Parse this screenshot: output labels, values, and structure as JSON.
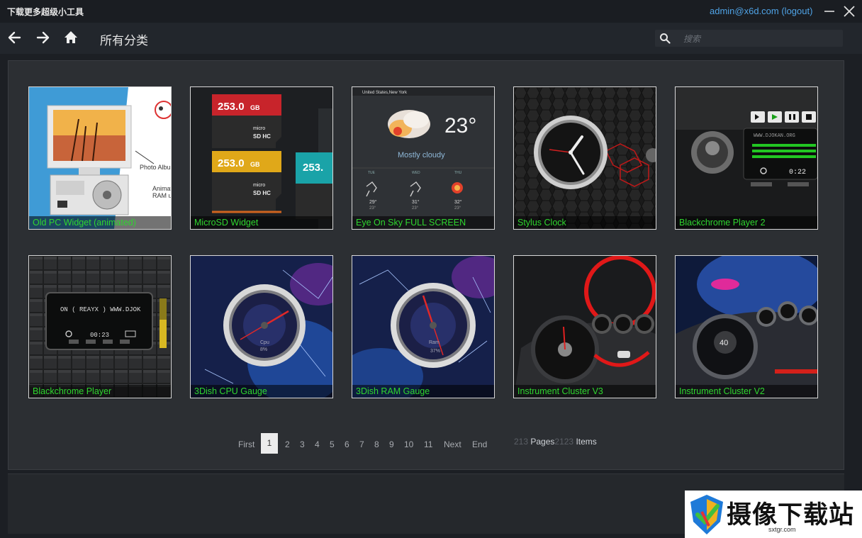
{
  "app": {
    "title": "下载更多超级小工具",
    "account": "admin@x6d.com (logout)"
  },
  "nav": {
    "page_title": "所有分类",
    "search_placeholder": "搜索"
  },
  "icons": {
    "back": "arrow-left-icon",
    "forward": "arrow-right-icon",
    "home": "home-icon",
    "search": "search-icon",
    "minimize": "minimize-icon",
    "close": "close-icon"
  },
  "widgets": [
    {
      "label": "Old PC Widget (animated)"
    },
    {
      "label": "MicroSD Widget"
    },
    {
      "label": "Eye On Sky FULL SCREEN"
    },
    {
      "label": "Stylus Clock"
    },
    {
      "label": "Blackchrome Player 2"
    },
    {
      "label": "Blackchrome Player"
    },
    {
      "label": "3Dish CPU Gauge"
    },
    {
      "label": "3Dish RAM Gauge"
    },
    {
      "label": "Instrument Cluster V3"
    },
    {
      "label": "Instrument Cluster V2"
    }
  ],
  "thumbs": {
    "sd_capacity": "253.0",
    "sd_unit": "GB",
    "sd_brand": "micro SD HC",
    "weather_location": "United States,New York",
    "weather_temp": "23°",
    "weather_desc": "Mostly cloudy",
    "forecast_days": [
      "TUE",
      "WED",
      "THU"
    ],
    "forecast_highs": [
      "29°",
      "31°",
      "32°"
    ],
    "forecast_lows": [
      "23°",
      "23°",
      "23°"
    ],
    "player_url": "WWW.DJOKAN.ORG",
    "player_time": "0:22",
    "player1_url": "ON ( REAYX ) WWW.DJOK",
    "player1_time": "00:23",
    "cpu_label": "Cpu",
    "cpu_value": "8%",
    "ram_label": "Ram",
    "ram_value": "37%",
    "cluster_v2_value": "40"
  },
  "pagination": {
    "first": "First",
    "current": "1",
    "pages": [
      "2",
      "3",
      "4",
      "5",
      "6",
      "7",
      "8",
      "9",
      "10",
      "11"
    ],
    "next": "Next",
    "end": "End",
    "total_pages": "213",
    "pages_label": "Pages",
    "total_items": "2123",
    "items_label": "Items"
  },
  "watermark": {
    "text": "摄像下载站",
    "sub": "sxtgr.com"
  },
  "colors": {
    "accent_link": "#4fa3e6",
    "label_green": "#2fd62f",
    "panel": "#2c2f33",
    "background": "#1c1f24"
  }
}
